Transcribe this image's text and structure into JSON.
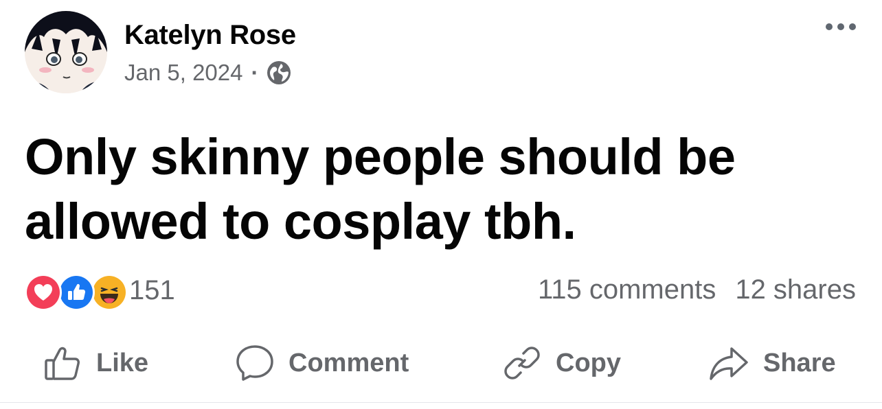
{
  "post": {
    "author": "Katelyn Rose",
    "date": "Jan 5, 2024",
    "separator": "·",
    "audience_icon": "globe-icon",
    "text": "Only skinny people should be allowed to cosplay tbh."
  },
  "reactions": {
    "icons": [
      "love-reaction-icon",
      "like-reaction-icon",
      "haha-reaction-icon"
    ],
    "count": "151",
    "comments": "115 comments",
    "shares": "12 shares"
  },
  "actions": {
    "like": "Like",
    "comment": "Comment",
    "copy": "Copy",
    "share": "Share"
  },
  "colors": {
    "text": "#050505",
    "secondary": "#65676b",
    "love": "#f33e58",
    "like": "#1877f2",
    "haha": "#f7b125"
  }
}
